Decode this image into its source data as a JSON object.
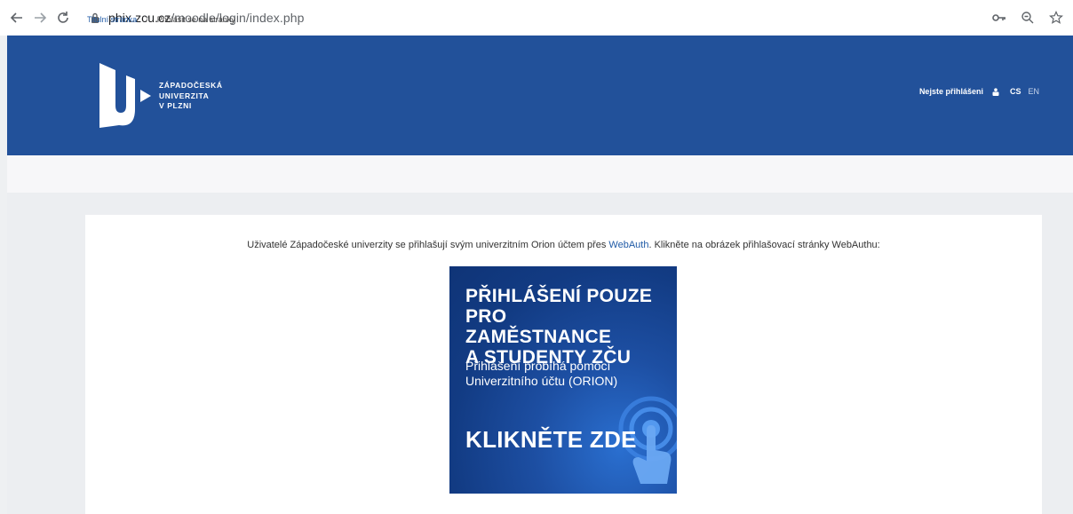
{
  "browser": {
    "url_host": "phix.zcu.cz",
    "url_path": "/moodle/login/index.php",
    "icons": [
      "back-arrow-icon",
      "forward-arrow-icon",
      "reload-icon",
      "lock-icon",
      "key-icon",
      "zoom-icon",
      "star-icon"
    ]
  },
  "header": {
    "logo_line1": "ZÁPADOČESKÁ",
    "logo_line2": "UNIVERZITA",
    "logo_line3": "V PLZNI",
    "login_status": "Nejste přihlášeni",
    "lang_cs": "CS",
    "lang_en": "EN",
    "bg_color": "#22519a"
  },
  "breadcrumb": {
    "home": "Titulní stránka",
    "separator": "/",
    "current": "Přihlásit se na stránky"
  },
  "main": {
    "intro_before": "Uživatelé Západočeské univerzity se přihlašují svým univerzitním Orion účtem přes ",
    "intro_link": "WebAuth",
    "intro_after": ". Klikněte na obrázek přihlašovací stránky WebAuthu:",
    "banner": {
      "title_line1": "PŘIHLÁŠENÍ POUZE PRO",
      "title_line2": "ZAMĚSTNANCE",
      "title_line3": "A STUDENTY ZČU",
      "sub_line1": "Přihlášení probíhá pomocí",
      "sub_line2": "Univerzitního účtu (ORION)",
      "cta": "KLIKNĚTE ZDE"
    }
  }
}
